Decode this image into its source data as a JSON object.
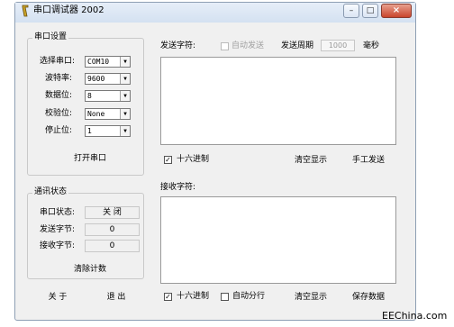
{
  "window": {
    "title": "串口调试器 2002",
    "controls": {
      "minimize": "–",
      "maximize": "□",
      "close": "×"
    }
  },
  "serial_settings": {
    "group_title": "串口设置",
    "port_label": "选择串口:",
    "port_value": "COM10",
    "baud_label": "波特率:",
    "baud_value": "9600",
    "databits_label": "数据位:",
    "databits_value": "8",
    "parity_label": "校验位:",
    "parity_value": "None",
    "stopbits_label": "停止位:",
    "stopbits_value": "1",
    "open_button": "打开串口"
  },
  "comm_status": {
    "group_title": "通讯状态",
    "port_status_label": "串口状态:",
    "port_status_value": "关 闭",
    "sent_label": "发送字节:",
    "sent_value": "0",
    "received_label": "接收字节:",
    "received_value": "0",
    "clear_count_button": "清除计数"
  },
  "send": {
    "label": "发送字符:",
    "auto_send_label": "自动发送",
    "auto_send_checked": false,
    "period_label": "发送周期",
    "period_value": "1000",
    "period_unit": "毫秒",
    "text": "",
    "hex_label": "十六进制",
    "hex_checked": true,
    "clear_display_button": "清空显示",
    "manual_send_button": "手工发送"
  },
  "receive": {
    "label": "接收字符:",
    "text": "",
    "hex_label": "十六进制",
    "hex_checked": true,
    "auto_wrap_label": "自动分行",
    "auto_wrap_checked": false,
    "clear_display_button": "清空显示",
    "save_button": "保存数据"
  },
  "footer": {
    "about_button": "关 于",
    "exit_button": "退 出"
  },
  "watermark": "EEChina.com",
  "colors": {
    "close_button": "#c9452c",
    "titlebar": "#d4e1f1",
    "window_bg": "#f0f0f0"
  }
}
